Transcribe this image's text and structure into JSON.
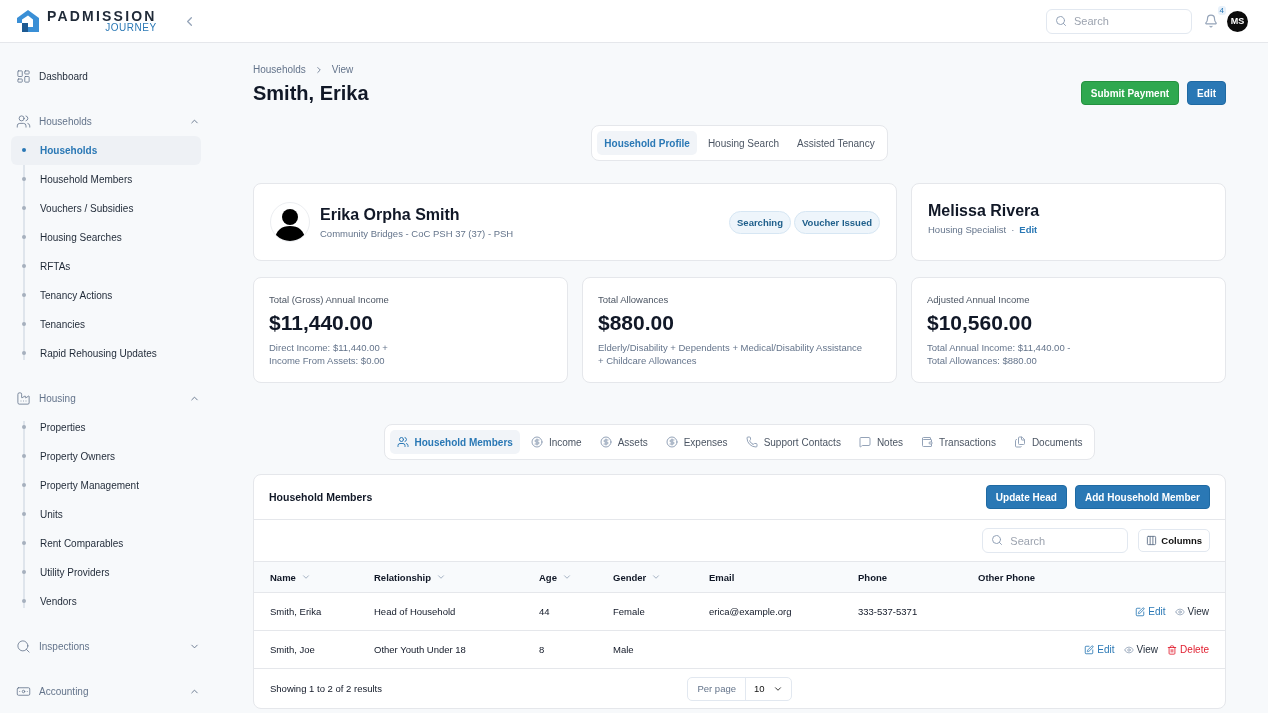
{
  "logo": {
    "name": "PADMISSION",
    "sub": "JOURNEY"
  },
  "header": {
    "search": {
      "placeholder": "Search"
    },
    "notifications": "4",
    "avatar": "MS"
  },
  "sidebar": {
    "sections": [
      {
        "label": "Dashboard"
      },
      {
        "label": "Households",
        "expanded": true,
        "children": [
          {
            "label": "Households",
            "selected": true
          },
          {
            "label": "Household Members",
            "selected": false
          },
          {
            "label": "Vouchers / Subsidies",
            "selected": false
          },
          {
            "label": "Housing Searches",
            "selected": false
          },
          {
            "label": "RFTAs",
            "selected": false
          },
          {
            "label": "Tenancy Actions",
            "selected": false
          },
          {
            "label": "Tenancies",
            "selected": false
          },
          {
            "label": "Rapid Rehousing Updates",
            "selected": false
          }
        ]
      },
      {
        "label": "Housing",
        "expanded": true,
        "children": [
          {
            "label": "Properties",
            "selected": false
          },
          {
            "label": "Property Owners",
            "selected": false
          },
          {
            "label": "Property Management",
            "selected": false
          },
          {
            "label": "Units",
            "selected": false
          },
          {
            "label": "Rent Comparables",
            "selected": false
          },
          {
            "label": "Utility Providers",
            "selected": false
          },
          {
            "label": "Vendors",
            "selected": false
          }
        ]
      },
      {
        "label": "Inspections",
        "expanded": false
      },
      {
        "label": "Accounting",
        "expanded": true
      }
    ]
  },
  "breadcrumb": [
    "Households",
    "View"
  ],
  "title": "Smith, Erika",
  "actions": [
    {
      "label": "Submit Payment",
      "kind": "success"
    },
    {
      "label": "Edit",
      "kind": "primary"
    }
  ],
  "profile_tabs": [
    {
      "label": "Household Profile",
      "selected": true
    },
    {
      "label": "Housing Search",
      "selected": false
    },
    {
      "label": "Assisted Tenancy",
      "selected": false
    }
  ],
  "person": {
    "name": "Erika Orpha Smith",
    "subtitle": "Community Bridges - CoC PSH 37 (37) - PSH",
    "badges": [
      "Searching",
      "Voucher Issued"
    ]
  },
  "specialist": {
    "name": "Melissa Rivera",
    "role": "Housing Specialist",
    "separator": "·",
    "link": "Edit"
  },
  "stats": [
    {
      "label": "Total (Gross) Annual Income",
      "value": "$11,440.00",
      "note_lines": [
        "Direct Income: $11,440.00 +",
        "Income From Assets: $0.00"
      ]
    },
    {
      "label": "Total Allowances",
      "value": "$880.00",
      "note_lines": [
        "Elderly/Disability + Dependents + Medical/Disability Assistance",
        "+ Childcare Allowances"
      ]
    },
    {
      "label": "Adjusted Annual Income",
      "value": "$10,560.00",
      "note_lines": [
        "Total Annual Income: $11,440.00 -",
        "Total Allowances: $880.00"
      ]
    }
  ],
  "section_tabs": [
    {
      "label": "Household Members",
      "selected": true
    },
    {
      "label": "Income",
      "selected": false
    },
    {
      "label": "Assets",
      "selected": false
    },
    {
      "label": "Expenses",
      "selected": false
    },
    {
      "label": "Support Contacts",
      "selected": false
    },
    {
      "label": "Notes",
      "selected": false
    },
    {
      "label": "Transactions",
      "selected": false
    },
    {
      "label": "Documents",
      "selected": false
    }
  ],
  "members": {
    "title": "Household Members",
    "buttons": [
      "Update Head",
      "Add Household Member"
    ],
    "search": {
      "placeholder": "Search"
    },
    "columns_button": "Columns",
    "columns": [
      {
        "label": "Name",
        "sortable": true
      },
      {
        "label": "Relationship",
        "sortable": true
      },
      {
        "label": "Age",
        "sortable": true
      },
      {
        "label": "Gender",
        "sortable": true
      },
      {
        "label": "Email",
        "sortable": false
      },
      {
        "label": "Phone",
        "sortable": false
      },
      {
        "label": "Other Phone",
        "sortable": false
      }
    ],
    "rows": [
      {
        "cells": [
          "Smith, Erika",
          "Head of Household",
          "44",
          "Female",
          "erica@example.org",
          "333-537-5371"
        ],
        "actions": [
          {
            "label": "Edit",
            "kind": "edit"
          },
          {
            "label": "View",
            "kind": "view"
          }
        ]
      },
      {
        "cells": [
          "Smith, Joe",
          "Other Youth Under 18",
          "8",
          "Male"
        ],
        "actions": [
          {
            "label": "Edit",
            "kind": "edit"
          },
          {
            "label": "View",
            "kind": "view"
          },
          {
            "label": "Delete",
            "kind": "delete"
          }
        ]
      }
    ],
    "summary": "Showing 1 to 2 of 2 results",
    "per_page_label": "Per page",
    "per_page": "10"
  }
}
